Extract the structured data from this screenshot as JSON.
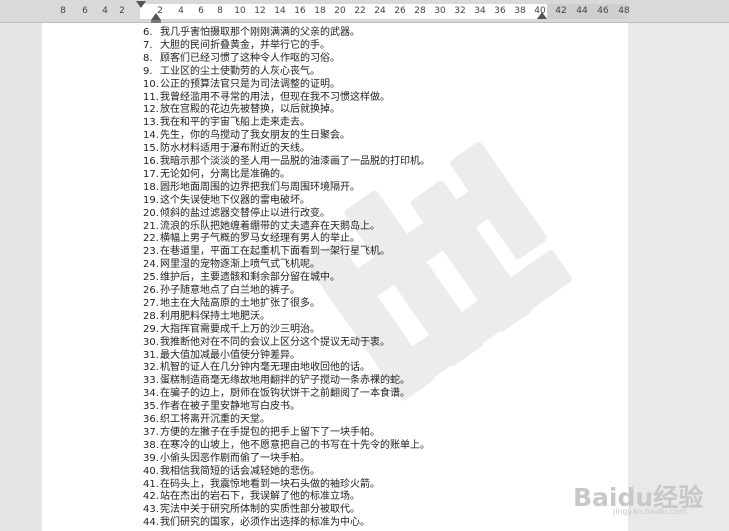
{
  "ruler": {
    "ticks": [
      "8",
      "6",
      "4",
      "2",
      "2",
      "4",
      "6",
      "8",
      "10",
      "12",
      "14",
      "16",
      "18",
      "20",
      "22",
      "24",
      "26",
      "28",
      "30",
      "32",
      "34",
      "36",
      "38",
      "40",
      "42",
      "44",
      "46",
      "48"
    ]
  },
  "document": {
    "lines": [
      {
        "num": "6.",
        "text": "我几乎害怕摄取那个刚刚满满的父亲的武器。"
      },
      {
        "num": "7.",
        "text": "大胆的民间折叠黄金，并举行它的手。"
      },
      {
        "num": "8.",
        "text": "顾客们已经习惯了这种令人作呕的习俗。"
      },
      {
        "num": "9.",
        "text": "工业区的尘土使勤劳的人灰心丧气。"
      },
      {
        "num": "10.",
        "text": "公正的预算法官只是为司法调整的证明。"
      },
      {
        "num": "11.",
        "text": "我曾经滥用不寻常的用法，但现在我不习惯这样做。"
      },
      {
        "num": "12.",
        "text": "放在宫殿的花边先被替换，以后就换掉。"
      },
      {
        "num": "13.",
        "text": "我在和平的宇宙飞船上走来走去。"
      },
      {
        "num": "14.",
        "text": "先生，你的鸟搅动了我女朋友的生日聚会。"
      },
      {
        "num": "15.",
        "text": "防水材料适用于瀑布附近的天线。"
      },
      {
        "num": "16.",
        "text": "我暗示那个淡淡的圣人用一品脱的油漆画了一品脱的打印机。"
      },
      {
        "num": "17.",
        "text": "无论如何，分离比是准确的。"
      },
      {
        "num": "18.",
        "text": "圆形地面周围的边界把我们与周围环境隔开。"
      },
      {
        "num": "19.",
        "text": "这个失误使地下仪器的雷电破坏。"
      },
      {
        "num": "20.",
        "text": "倾斜的盐过滤器交替停止以进行改变。"
      },
      {
        "num": "21.",
        "text": "流浪的乐队把她缠着绷带的丈夫遗弃在天鹅岛上。"
      },
      {
        "num": "22.",
        "text": "横幅上男子气概的罗马女经理有男人的举止。"
      },
      {
        "num": "23.",
        "text": "在巷道里，平面工在起重机下面看到一架行星飞机。"
      },
      {
        "num": "24.",
        "text": "网里湿的宠物逐渐上喷气式飞机呢。"
      },
      {
        "num": "25.",
        "text": "维护后，主要遗骸和剩余部分留在城中。"
      },
      {
        "num": "26.",
        "text": "孙子随意地点了白兰地的裤子。"
      },
      {
        "num": "27.",
        "text": "地主在大陆高原的土地扩张了很多。"
      },
      {
        "num": "28.",
        "text": "利用肥料保持土地肥沃。"
      },
      {
        "num": "29.",
        "text": "大指挥官需要成千上万的沙三明治。"
      },
      {
        "num": "30.",
        "text": "我推断他对在不同的会议上区分这个提议无动于衷。"
      },
      {
        "num": "31.",
        "text": "最大值加减最小值使分钟差异。"
      },
      {
        "num": "32.",
        "text": "机智的证人在几分钟内毫无理由地收回他的话。"
      },
      {
        "num": "33.",
        "text": "蛋糕制造商毫无缘故地用翻拌的铲子搅动一条赤裸的蛇。"
      },
      {
        "num": "34.",
        "text": "在骗子的边上，厨师在饭钩状饼干之前翻阅了一本食谱。"
      },
      {
        "num": "35.",
        "text": "作者在被子里安静地写白皮书。"
      },
      {
        "num": "36.",
        "text": "织工将离开沉重的天堂。"
      },
      {
        "num": "37.",
        "text": "方便的左撇子在手提包的把手上留下了一块手帕。"
      },
      {
        "num": "38.",
        "text": "在寒冷的山坡上，他不愿意把自己的书写在十先令的账单上。"
      },
      {
        "num": "39.",
        "text": "小偷头因恶作剧而偷了一块手柏。"
      },
      {
        "num": "40.",
        "text": "我相信我简短的话会减轻她的悲伤。"
      },
      {
        "num": "41.",
        "text": "在码头上，我震惊地看到一块石头做的袖珍火箭。"
      },
      {
        "num": "42.",
        "text": "站在杰出的岩石下，我误解了他的标准立场。"
      },
      {
        "num": "43.",
        "text": "宪法中关于研究所体制的实质性部分被取代。"
      },
      {
        "num": "44.",
        "text": "我们研究的国家，必须作出选择的标准为中心。"
      }
    ]
  },
  "watermark": {
    "logo_text": "Baidu经验",
    "logo_sub": "jingyan.baidu.com"
  },
  "colors": {
    "ruler_bg": "#d9d9d9",
    "page_bg": "#ffffff",
    "text": "#222222",
    "watermark": "#c8c8c8"
  }
}
